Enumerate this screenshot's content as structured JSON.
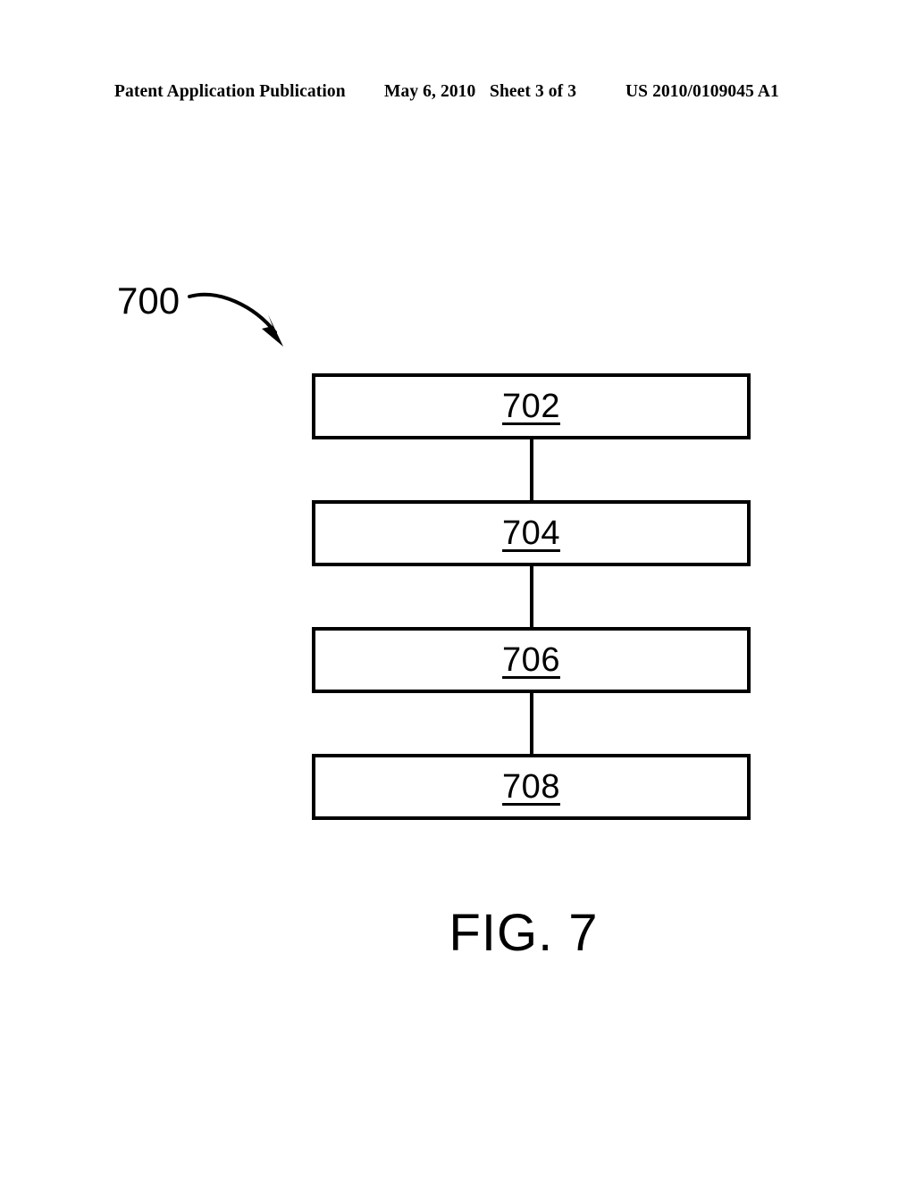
{
  "page": {
    "background_color": "#ffffff",
    "ink_color": "#000000"
  },
  "header": {
    "publication": "Patent Application Publication",
    "date": "May 6, 2010",
    "sheet": "Sheet 3 of 3",
    "publication_number": "US 2010/0109045 A1"
  },
  "figure": {
    "reference_numeral": "700",
    "caption": "FIG. 7",
    "lead_arrow": "curved-arrow-icon",
    "flow_steps": [
      {
        "label": "702"
      },
      {
        "label": "704"
      },
      {
        "label": "706"
      },
      {
        "label": "708"
      }
    ],
    "connectors": [
      {
        "from": "702",
        "to": "704"
      },
      {
        "from": "704",
        "to": "706"
      },
      {
        "from": "706",
        "to": "708"
      }
    ]
  }
}
